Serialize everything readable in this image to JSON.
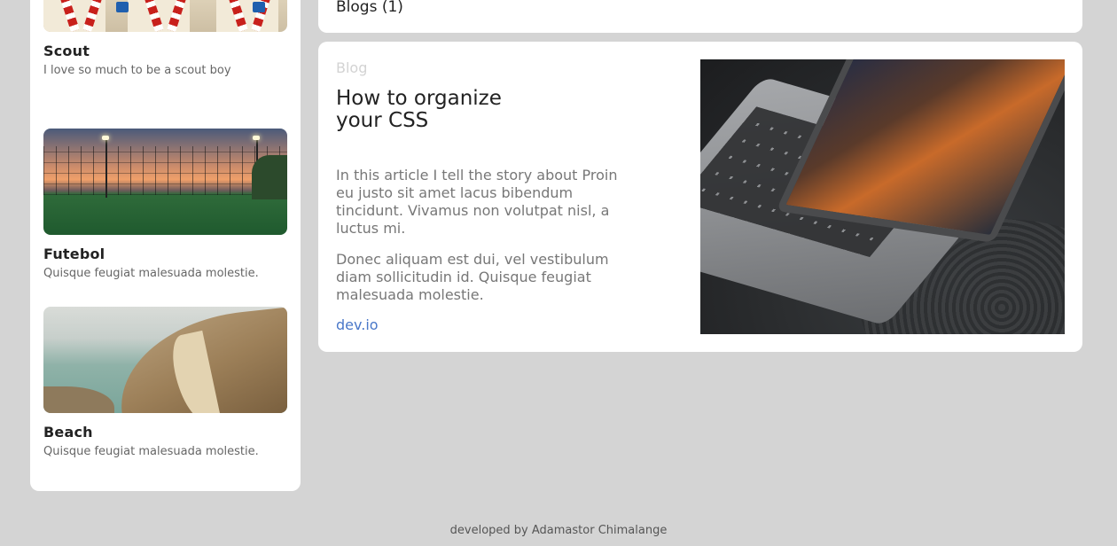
{
  "sidebar": {
    "items": [
      {
        "title": "Scout",
        "description": "I love so much to be a scout boy",
        "image": "scout-photo"
      },
      {
        "title": "Futebol",
        "description": "Quisque feugiat malesuada molestie.",
        "image": "football-field-photo"
      },
      {
        "title": "Beach",
        "description": "Quisque feugiat malesuada molestie.",
        "image": "beach-photo"
      }
    ]
  },
  "blogs_header": {
    "label": "Blogs (1)"
  },
  "article": {
    "category": "Blog",
    "title": "How to organize your CSS",
    "paragraphs": [
      "In this article I tell the story about Proin eu justo sit amet lacus bibendum tincidunt. Vivamus non volutpat nisl, a luctus mi.",
      "Donec aliquam est dui, vel vestibulum diam sollicitudin id. Quisque feugiat malesuada molestie."
    ],
    "link": "dev.io",
    "image": "laptop-photo"
  },
  "footer": {
    "text": "developed by Adamastor Chimalange"
  },
  "colors": {
    "background": "#d4d4d4",
    "card": "#ffffff",
    "link": "#4a78c9",
    "muted": "#777777"
  }
}
